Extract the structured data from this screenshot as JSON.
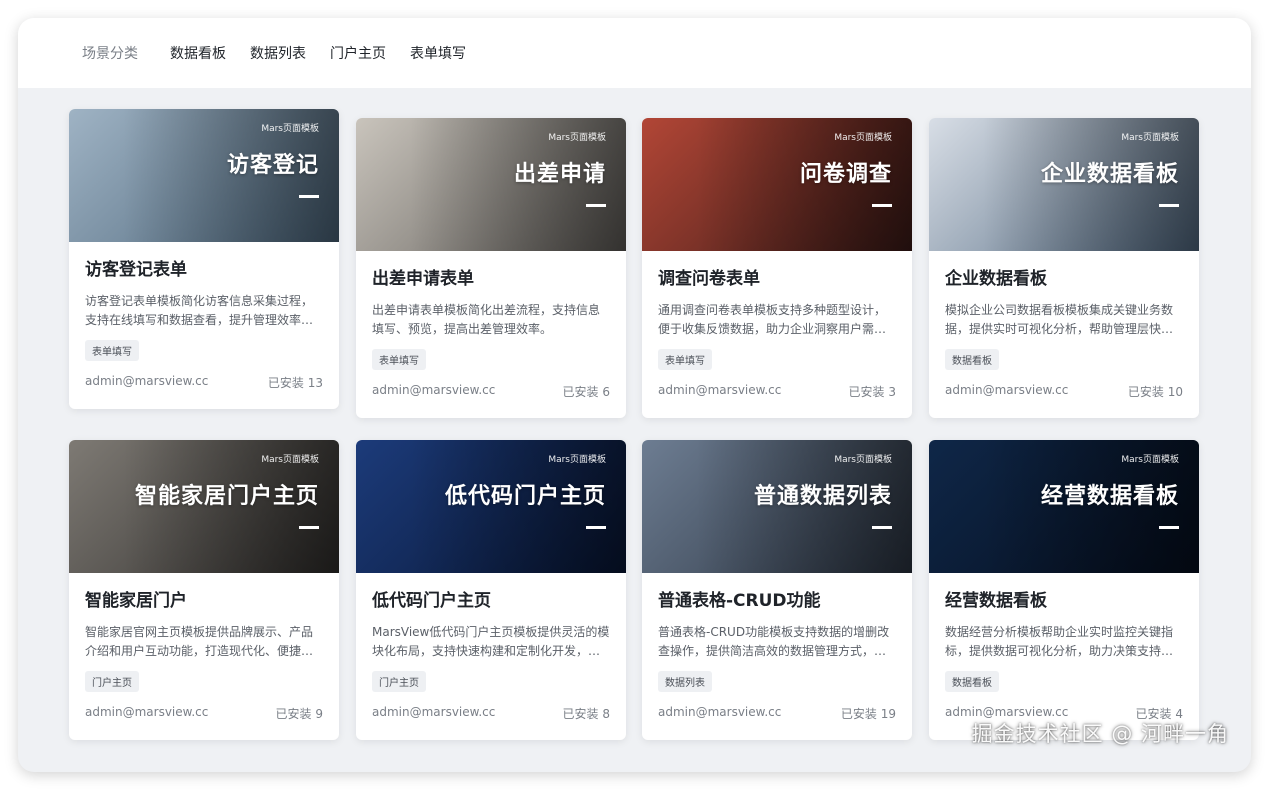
{
  "nav": {
    "label": "场景分类",
    "items": [
      "数据看板",
      "数据列表",
      "门户主页",
      "表单填写"
    ]
  },
  "cards": [
    {
      "cover_brand": "Mars页面模板",
      "cover_title": "访客登记",
      "title": "访客登记表单",
      "desc": "访客登记表单模板简化访客信息采集过程，支持在线填写和数据查看，提升管理效率…",
      "tag": "表单填写",
      "author": "admin@marsview.cc",
      "installs": "已安装 13",
      "colors": [
        "#9fb3c4",
        "#4a6378"
      ]
    },
    {
      "cover_brand": "Mars页面模板",
      "cover_title": "出差申请",
      "title": "出差申请表单",
      "desc": "出差申请表单模板简化出差流程，支持信息填写、预览，提高出差管理效率。",
      "tag": "表单填写",
      "author": "admin@marsview.cc",
      "installs": "已安装 6",
      "colors": [
        "#c9c4bc",
        "#5d5a56"
      ]
    },
    {
      "cover_brand": "Mars页面模板",
      "cover_title": "问卷调查",
      "title": "调查问卷表单",
      "desc": "通用调查问卷表单模板支持多种题型设计，便于收集反馈数据，助力企业洞察用户需…",
      "tag": "表单填写",
      "author": "admin@marsview.cc",
      "installs": "已安装 3",
      "colors": [
        "#b24636",
        "#3a1a17"
      ]
    },
    {
      "cover_brand": "Mars页面模板",
      "cover_title": "企业数据看板",
      "title": "企业数据看板",
      "desc": "模拟企业公司数据看板模板集成关键业务数据，提供实时可视化分析，帮助管理层快…",
      "tag": "数据看板",
      "author": "admin@marsview.cc",
      "installs": "已安装 10",
      "colors": [
        "#d8dee6",
        "#50677f"
      ]
    },
    {
      "cover_brand": "Mars页面模板",
      "cover_title": "智能家居门户主页",
      "title": "智能家居门户",
      "desc": "智能家居官网主页模板提供品牌展示、产品介绍和用户互动功能，打造现代化、便捷…",
      "tag": "门户主页",
      "author": "admin@marsview.cc",
      "installs": "已安装 9",
      "colors": [
        "#7e7a74",
        "#2f2d2b"
      ]
    },
    {
      "cover_brand": "Mars页面模板",
      "cover_title": "低代码门户主页",
      "title": "低代码门户主页",
      "desc": "MarsView低代码门户主页模板提供灵活的模块化布局，支持快速构建和定制化开发，…",
      "tag": "门户主页",
      "author": "admin@marsview.cc",
      "installs": "已安装 8",
      "colors": [
        "#1c3b7a",
        "#081634"
      ]
    },
    {
      "cover_brand": "Mars页面模板",
      "cover_title": "普通数据列表",
      "title": "普通表格-CRUD功能",
      "desc": "普通表格-CRUD功能模板支持数据的增删改查操作，提供简洁高效的数据管理方式，…",
      "tag": "数据列表",
      "author": "admin@marsview.cc",
      "installs": "已安装 19",
      "colors": [
        "#6d7d92",
        "#2a3340"
      ]
    },
    {
      "cover_brand": "Mars页面模板",
      "cover_title": "经营数据看板",
      "title": "经营数据看板",
      "desc": "数据经营分析模板帮助企业实时监控关键指标，提供数据可视化分析，助力决策支持…",
      "tag": "数据看板",
      "author": "admin@marsview.cc",
      "installs": "已安装 4",
      "colors": [
        "#0f2748",
        "#050e1e"
      ]
    }
  ],
  "watermark": "掘金技术社区 @ 河畔一角"
}
